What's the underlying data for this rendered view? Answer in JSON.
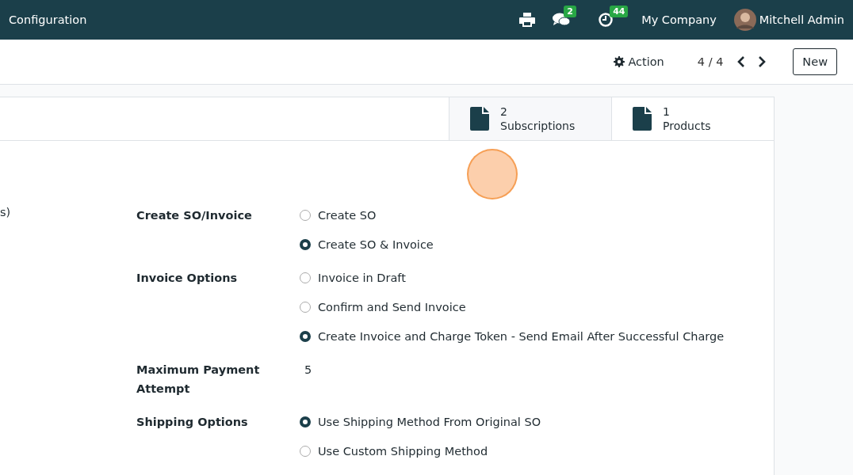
{
  "navbar": {
    "title": "Configuration",
    "messages_badge": "2",
    "activities_badge": "44",
    "company": "My Company",
    "user": "Mitchell Admin"
  },
  "control_panel": {
    "action": "Action",
    "pager": "4 / 4",
    "new_button": "New"
  },
  "smart_buttons": [
    {
      "value": "2",
      "label": "Subscriptions",
      "color": "#1b3f4a"
    },
    {
      "value": "1",
      "label": "Products",
      "color": "#1b3f4a"
    }
  ],
  "left_fragment": "s)",
  "fields": [
    {
      "label": "Create SO/Invoice",
      "kind": "radio",
      "options": [
        {
          "label": "Create SO",
          "selected": false
        },
        {
          "label": "Create SO & Invoice",
          "selected": true
        }
      ]
    },
    {
      "label": "Invoice Options",
      "kind": "radio",
      "options": [
        {
          "label": "Invoice in Draft",
          "selected": false
        },
        {
          "label": "Confirm and Send Invoice",
          "selected": false
        },
        {
          "label": "Create Invoice and Charge Token - Send Email After Successful Charge",
          "selected": true
        }
      ]
    },
    {
      "label": "Maximum Payment Attempt",
      "kind": "value",
      "value": "5"
    },
    {
      "label": "Shipping Options",
      "kind": "radio",
      "options": [
        {
          "label": "Use Shipping Method From Original SO",
          "selected": true
        },
        {
          "label": "Use Custom Shipping Method",
          "selected": false
        }
      ]
    }
  ]
}
